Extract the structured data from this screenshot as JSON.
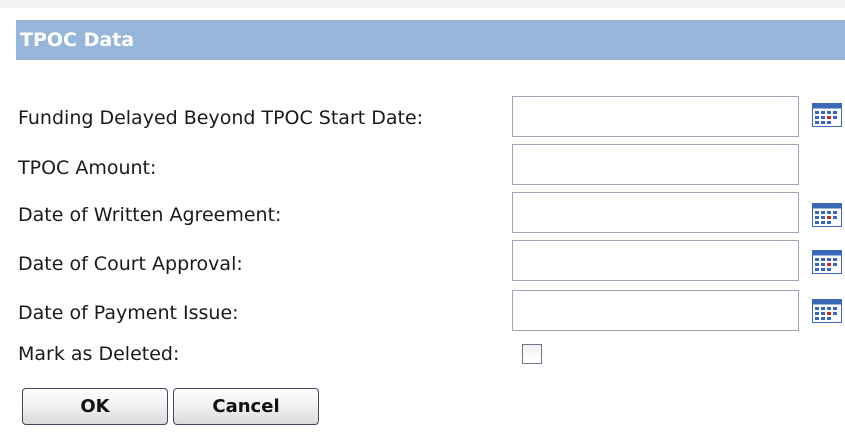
{
  "section": {
    "title": "TPOC Data"
  },
  "form": {
    "funding_delayed": {
      "label": "Funding Delayed Beyond TPOC Start Date:",
      "value": ""
    },
    "tpoc_amount": {
      "label": "TPOC Amount:",
      "value": ""
    },
    "date_written_agreement": {
      "label": "Date of Written Agreement:",
      "value": ""
    },
    "date_court_approval": {
      "label": "Date of Court Approval:",
      "value": ""
    },
    "date_payment_issue": {
      "label": "Date of Payment Issue:",
      "value": ""
    },
    "mark_as_deleted": {
      "label": "Mark as Deleted:",
      "checked": false
    }
  },
  "buttons": {
    "ok_label": "OK",
    "cancel_label": "Cancel"
  },
  "icons": {
    "calendar": "calendar-icon"
  },
  "colors": {
    "header_bg": "#98b6d9",
    "header_text": "#ffffff",
    "field_border": "#9fa8b6",
    "calendar_blue": "#3b67b8",
    "calendar_red": "#cc2a1a"
  }
}
